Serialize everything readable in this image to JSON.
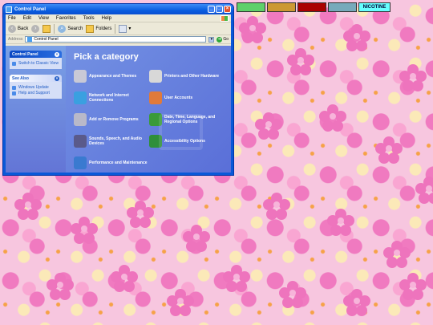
{
  "window": {
    "title": "Control Panel",
    "menu": [
      "File",
      "Edit",
      "View",
      "Favorites",
      "Tools",
      "Help"
    ],
    "toolbar": {
      "back": "Back",
      "search": "Search",
      "folders": "Folders"
    },
    "address": {
      "label": "Address",
      "value": "Control Panel",
      "go": "Go"
    }
  },
  "sidebar": {
    "panels": [
      {
        "title": "Control Panel",
        "links": [
          "Switch to Classic View"
        ]
      },
      {
        "title": "See Also",
        "links": [
          "Windows Update",
          "Help and Support"
        ]
      }
    ]
  },
  "main": {
    "heading": "Pick a category",
    "categories": [
      {
        "label": "Appearance and Themes",
        "icon": "appearance-icon",
        "color": "#c9c9d6"
      },
      {
        "label": "Printers and Other Hardware",
        "icon": "printer-icon",
        "color": "#d8d8d8"
      },
      {
        "label": "Network and Internet Connections",
        "icon": "network-icon",
        "color": "#3aa0e0"
      },
      {
        "label": "User Accounts",
        "icon": "users-icon",
        "color": "#e07a3a"
      },
      {
        "label": "Add or Remove Programs",
        "icon": "programs-icon",
        "color": "#b9b9c9"
      },
      {
        "label": "Date, Time, Language, and Regional Options",
        "icon": "datetime-icon",
        "color": "#3a9a3a"
      },
      {
        "label": "Sounds, Speech, and Audio Devices",
        "icon": "sound-icon",
        "color": "#5a5a8a"
      },
      {
        "label": "Accessibility Options",
        "icon": "accessibility-icon",
        "color": "#2f8f3a"
      },
      {
        "label": "Performance and Maintenance",
        "icon": "performance-icon",
        "color": "#3a7ad0"
      }
    ]
  },
  "desktop": {
    "badges": [
      "NICOTINE"
    ]
  },
  "colors": {
    "titlebar": "#0a5ee0",
    "desktop_pink": "#f7c6df",
    "flower": "#ee74bd",
    "panel_blue": "#7391e3"
  }
}
